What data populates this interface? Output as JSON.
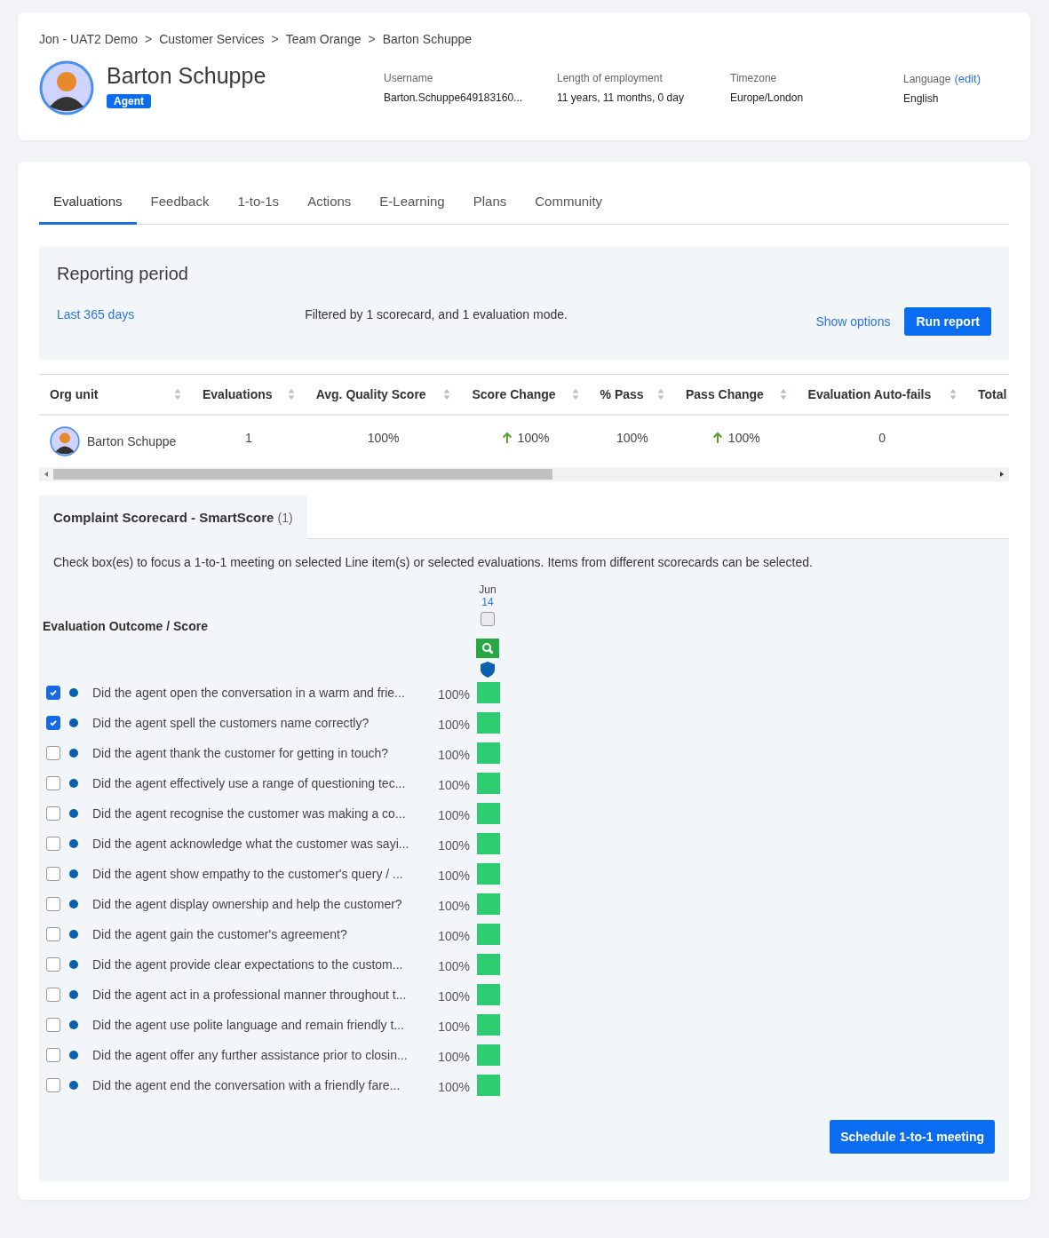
{
  "breadcrumb": [
    {
      "label": "Jon - UAT2 Demo"
    },
    {
      "label": "Customer Services"
    },
    {
      "label": "Team Orange"
    },
    {
      "label": "Barton Schuppe"
    }
  ],
  "breadcrumb_separator": ">",
  "profile": {
    "name": "Barton Schuppe",
    "badge": "Agent",
    "fields": [
      {
        "label": "Username",
        "value": "Barton.Schuppe649183160..."
      },
      {
        "label": "Length of employment",
        "value": "11 years, 11 months, 0 day"
      },
      {
        "label": "Timezone",
        "value": "Europe/London"
      },
      {
        "label": "Language",
        "link": "(edit)",
        "value": "English"
      }
    ]
  },
  "tabs": [
    {
      "label": "Evaluations",
      "selected": true
    },
    {
      "label": "Feedback",
      "selected": false
    },
    {
      "label": "1-to-1s",
      "selected": false
    },
    {
      "label": "Actions",
      "selected": false
    },
    {
      "label": "E-Learning",
      "selected": false
    },
    {
      "label": "Plans",
      "selected": false
    },
    {
      "label": "Community",
      "selected": false
    }
  ],
  "reporting": {
    "title": "Reporting period",
    "period": "Last 365 days",
    "filter": "Filtered by 1 scorecard, and 1 evaluation mode.",
    "show_options": "Show options",
    "run_button": "Run report"
  },
  "table": {
    "columns": [
      "Org unit",
      "Evaluations",
      "Avg. Quality Score",
      "Score Change",
      "% Pass",
      "Pass Change",
      "Evaluation Auto-fails",
      "Total"
    ],
    "rows": [
      {
        "org_unit": "Barton Schuppe",
        "evaluations": "1",
        "avg_quality": "100%",
        "score_change": "100%",
        "score_up": true,
        "pass": "100%",
        "pass_change": "100%",
        "pass_up": true,
        "auto_fails": "0"
      }
    ]
  },
  "scorecard_tab": {
    "label": "Complaint Scorecard - SmartScore",
    "count": "(1)"
  },
  "instructions": "Check box(es) to focus a 1-to-1 meeting on selected Line item(s) or selected evaluations. Items from different scorecards can be selected.",
  "outcome": {
    "heading": "Evaluation Outcome / Score",
    "date_month": "Jun",
    "date_day": "14",
    "date_checked": false,
    "items": [
      {
        "text": "Did the agent open the conversation in a warm and frie...",
        "checked": true,
        "score": "100%"
      },
      {
        "text": "Did the agent spell the customers name correctly?",
        "checked": true,
        "score": "100%"
      },
      {
        "text": "Did the agent thank the customer for getting in touch?",
        "checked": false,
        "score": "100%"
      },
      {
        "text": "Did the agent effectively use a range of questioning tec...",
        "checked": false,
        "score": "100%"
      },
      {
        "text": "Did the agent recognise the customer was making a co...",
        "checked": false,
        "score": "100%"
      },
      {
        "text": "Did the agent acknowledge what the customer was sayi...",
        "checked": false,
        "score": "100%"
      },
      {
        "text": "Did the agent show empathy to the customer's query / ...",
        "checked": false,
        "score": "100%"
      },
      {
        "text": "Did the agent display ownership and help the customer?",
        "checked": false,
        "score": "100%"
      },
      {
        "text": "Did the agent gain the customer's agreement?",
        "checked": false,
        "score": "100%"
      },
      {
        "text": "Did the agent provide clear expectations to the custom...",
        "checked": false,
        "score": "100%"
      },
      {
        "text": "Did the agent act in a professional manner throughout t...",
        "checked": false,
        "score": "100%"
      },
      {
        "text": "Did the agent use polite language and remain friendly t...",
        "checked": false,
        "score": "100%"
      },
      {
        "text": "Did the agent offer any further assistance prior to closin...",
        "checked": false,
        "score": "100%"
      },
      {
        "text": "Did the agent end the conversation with a friendly fare...",
        "checked": false,
        "score": "100%"
      }
    ]
  },
  "schedule_button": "Schedule 1-to-1 meeting"
}
